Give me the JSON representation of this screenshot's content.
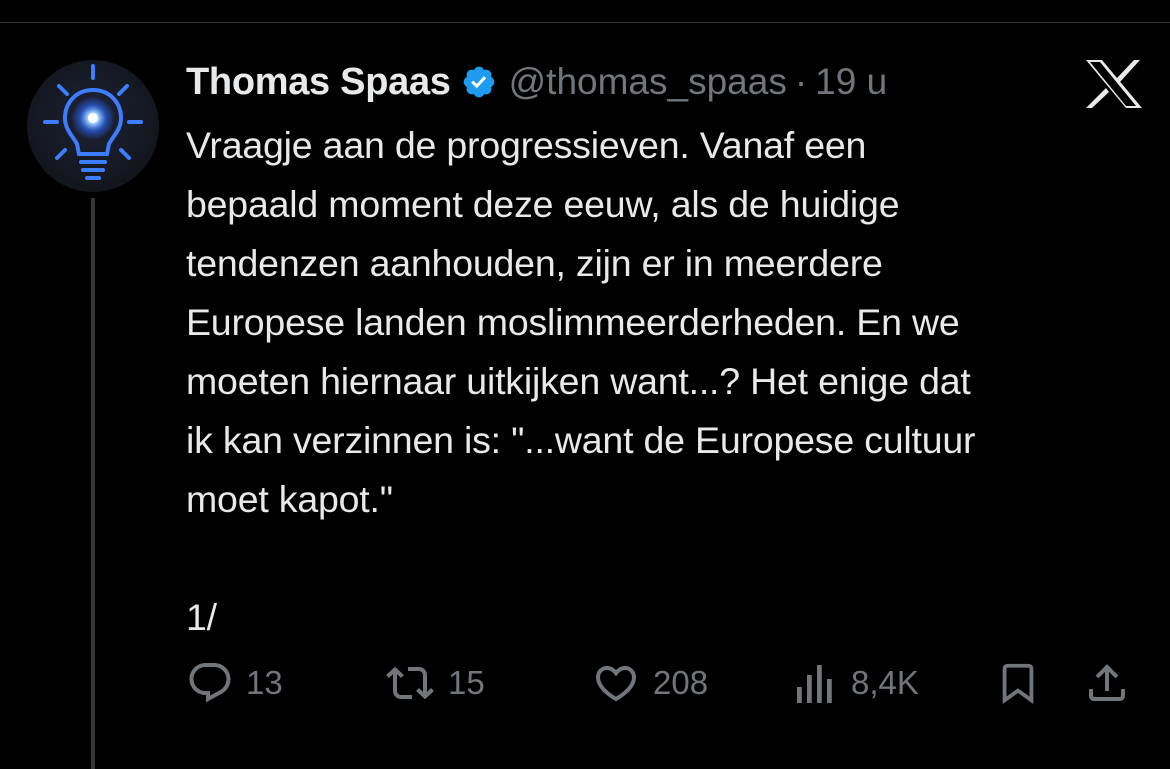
{
  "tweet": {
    "author_name": "Thomas Spaas",
    "handle": "@thomas_spaas",
    "separator": "·",
    "time": "19 u",
    "text_lines": [
      "Vraagje aan de progressieven. Vanaf een",
      "bepaald moment deze eeuw, als de huidige",
      "tendenzen aanhouden, zijn er in meerdere",
      "Europese landen moslimmeerderheden. En we",
      "moeten hiernaar uitkijken want...? Het enige dat",
      "ik kan verzinnen is: \"...want de Europese cultuur",
      "moet kapot.\""
    ],
    "thread_marker": "1/"
  },
  "actions": {
    "reply_count": "13",
    "retweet_count": "15",
    "like_count": "208",
    "views_count": "8,4K"
  },
  "icons": {
    "avatar": "lightbulb-avatar-icon",
    "verified": "verified-badge-icon",
    "logo": "x-logo-icon",
    "reply": "reply-icon",
    "retweet": "retweet-icon",
    "like": "heart-icon",
    "views": "views-icon",
    "bookmark": "bookmark-icon",
    "share": "share-icon"
  },
  "colors": {
    "background": "#000000",
    "text": "#e7e9ea",
    "muted": "#71767b",
    "verified": "#1d9bf0"
  }
}
